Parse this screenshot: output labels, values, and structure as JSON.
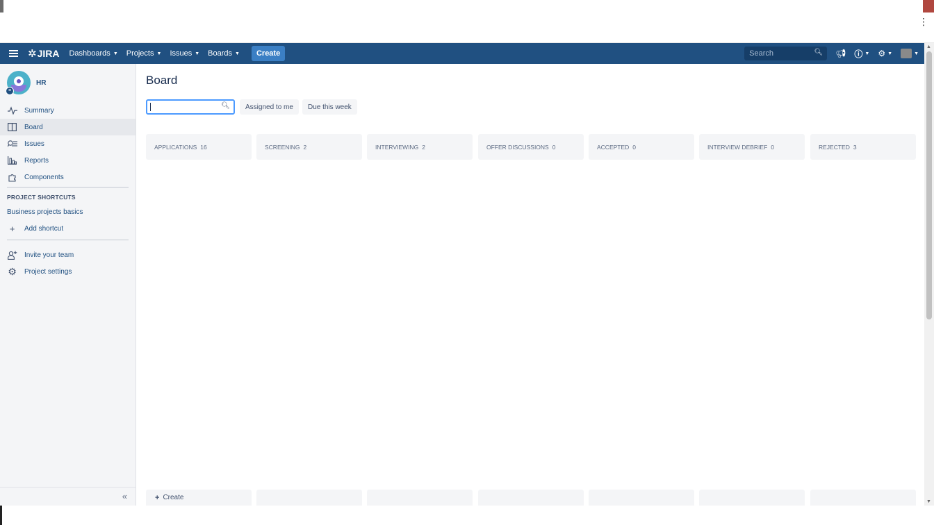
{
  "nav": {
    "logo": "JIRA",
    "items": [
      {
        "label": "Dashboards"
      },
      {
        "label": "Projects"
      },
      {
        "label": "Issues"
      },
      {
        "label": "Boards"
      }
    ],
    "create_label": "Create",
    "search_placeholder": "Search"
  },
  "sidebar": {
    "project_name": "HR",
    "items": [
      {
        "label": "Summary",
        "icon": "activity-icon"
      },
      {
        "label": "Board",
        "icon": "board-icon"
      },
      {
        "label": "Issues",
        "icon": "issues-icon"
      },
      {
        "label": "Reports",
        "icon": "reports-icon"
      },
      {
        "label": "Components",
        "icon": "components-icon"
      }
    ],
    "shortcuts_title": "PROJECT SHORTCUTS",
    "shortcut_link": "Business projects basics",
    "add_shortcut": "Add shortcut",
    "invite_team": "Invite your team",
    "project_settings": "Project settings"
  },
  "main": {
    "title": "Board",
    "quick_filters": [
      "Assigned to me",
      "Due this week"
    ],
    "columns": [
      {
        "name": "APPLICATIONS",
        "count": "16"
      },
      {
        "name": "SCREENING",
        "count": "2"
      },
      {
        "name": "INTERVIEWING",
        "count": "2"
      },
      {
        "name": "OFFER DISCUSSIONS",
        "count": "0"
      },
      {
        "name": "ACCEPTED",
        "count": "0"
      },
      {
        "name": "INTERVIEW DEBRIEF",
        "count": "0"
      },
      {
        "name": "REJECTED",
        "count": "3"
      }
    ],
    "create_label": "Create"
  },
  "colors": {
    "nav_bg": "#205081",
    "create_btn": "#3b7fc4",
    "link": "#205081"
  }
}
